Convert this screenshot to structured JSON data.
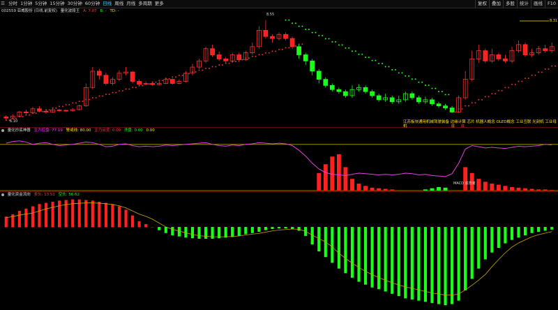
{
  "toolbar": {
    "periods": [
      "分时",
      "1分钟",
      "5分钟",
      "15分钟",
      "30分钟",
      "60分钟",
      "日线",
      "周线",
      "月线",
      "多周期",
      "更多"
    ],
    "active_period": "日线",
    "right_buttons": [
      "复权",
      "叠加",
      "多股",
      "统计",
      "画线",
      "F10"
    ]
  },
  "main_panel": {
    "header": [
      "002559 亚威股份 (日线,前复权)",
      "量化波段王",
      "A: 7.07",
      "B: -",
      "TD: -"
    ],
    "high_label": "8.55",
    "low_label": "6.10",
    "right_value": "8.31",
    "concepts_line1": "江苏板块通用机械驾驶装备 边缘计算 芯片 机器人概念 OLED概念 工业互联 光刻机 工业母机",
    "buy_tags": [
      "底",
      "底"
    ]
  },
  "kdj_panel": {
    "header": [
      "量化抄底神器",
      "主力控盘: 77.19",
      "警戒线: 80.00",
      "主力出货: 0.00",
      "洗盘: 0.00",
      "0.00"
    ],
    "macd_label": "MACD 底背离"
  },
  "flow_panel": {
    "header": [
      "量化资金流向",
      "多头: 13.51",
      "空头: 56.62"
    ]
  },
  "chart_data": {
    "type": "candlestick",
    "x_count": 83,
    "candles": [
      [
        6.18,
        6.15,
        6.22,
        6.1
      ],
      [
        6.15,
        6.2,
        6.24,
        6.12
      ],
      [
        6.2,
        6.3,
        6.33,
        6.18
      ],
      [
        6.3,
        6.28,
        6.36,
        6.24
      ],
      [
        6.28,
        6.38,
        6.42,
        6.26
      ],
      [
        6.38,
        6.32,
        6.44,
        6.3
      ],
      [
        6.32,
        6.3,
        6.36,
        6.26
      ],
      [
        6.3,
        6.35,
        6.38,
        6.28
      ],
      [
        6.35,
        6.34,
        6.38,
        6.3
      ],
      [
        6.34,
        6.33,
        6.36,
        6.3
      ],
      [
        6.33,
        6.36,
        6.4,
        6.31
      ],
      [
        6.36,
        6.45,
        6.48,
        6.34
      ],
      [
        6.45,
        6.9,
        7.0,
        6.43
      ],
      [
        6.9,
        7.3,
        7.4,
        6.85
      ],
      [
        7.3,
        7.2,
        7.36,
        7.1
      ],
      [
        7.2,
        7.0,
        7.26,
        6.95
      ],
      [
        7.0,
        7.1,
        7.15,
        6.95
      ],
      [
        7.1,
        7.25,
        7.32,
        7.05
      ],
      [
        7.25,
        7.28,
        7.4,
        7.2
      ],
      [
        7.28,
        7.05,
        7.3,
        7.0
      ],
      [
        7.05,
        6.98,
        7.1,
        6.95
      ],
      [
        6.98,
        7.0,
        7.05,
        6.95
      ],
      [
        7.0,
        6.97,
        7.05,
        6.94
      ],
      [
        6.97,
        7.0,
        7.05,
        6.95
      ],
      [
        7.0,
        7.1,
        7.15,
        6.98
      ],
      [
        7.1,
        7.0,
        7.12,
        6.97
      ],
      [
        7.0,
        7.05,
        7.1,
        6.98
      ],
      [
        7.05,
        7.25,
        7.3,
        7.02
      ],
      [
        7.25,
        7.4,
        7.48,
        7.2
      ],
      [
        7.4,
        7.55,
        7.6,
        7.35
      ],
      [
        7.55,
        7.85,
        7.9,
        7.5
      ],
      [
        7.85,
        7.7,
        7.95,
        7.65
      ],
      [
        7.7,
        7.6,
        7.78,
        7.55
      ],
      [
        7.6,
        7.55,
        7.65,
        7.5
      ],
      [
        7.55,
        7.7,
        7.75,
        7.5
      ],
      [
        7.7,
        7.58,
        7.75,
        7.52
      ],
      [
        7.58,
        7.75,
        7.8,
        7.55
      ],
      [
        7.75,
        7.9,
        8.0,
        7.7
      ],
      [
        7.9,
        8.3,
        8.4,
        7.85
      ],
      [
        8.3,
        8.15,
        8.55,
        8.1
      ],
      [
        8.15,
        8.1,
        8.2,
        8.0
      ],
      [
        8.1,
        8.2,
        8.25,
        8.05
      ],
      [
        8.2,
        8.1,
        8.25,
        8.05
      ],
      [
        8.1,
        7.9,
        8.15,
        7.85
      ],
      [
        7.9,
        7.7,
        7.95,
        7.6
      ],
      [
        7.7,
        7.55,
        7.75,
        7.45
      ],
      [
        7.55,
        7.3,
        7.6,
        7.2
      ],
      [
        7.3,
        7.1,
        7.35,
        7.0
      ],
      [
        7.1,
        6.95,
        7.15,
        6.9
      ],
      [
        6.95,
        6.85,
        7.0,
        6.8
      ],
      [
        6.85,
        6.8,
        6.9,
        6.75
      ],
      [
        6.8,
        6.7,
        6.85,
        6.65
      ],
      [
        6.7,
        6.85,
        6.95,
        6.65
      ],
      [
        6.85,
        6.9,
        6.98,
        6.8
      ],
      [
        6.9,
        6.8,
        6.95,
        6.75
      ],
      [
        6.8,
        6.7,
        6.85,
        6.65
      ],
      [
        6.7,
        6.6,
        6.75,
        6.55
      ],
      [
        6.6,
        6.65,
        6.75,
        6.55
      ],
      [
        6.65,
        6.55,
        6.7,
        6.5
      ],
      [
        6.55,
        6.6,
        6.7,
        6.5
      ],
      [
        6.6,
        6.75,
        6.8,
        6.55
      ],
      [
        6.75,
        6.65,
        6.8,
        6.6
      ],
      [
        6.65,
        6.55,
        6.7,
        6.5
      ],
      [
        6.55,
        6.6,
        6.68,
        6.5
      ],
      [
        6.6,
        6.5,
        6.65,
        6.45
      ],
      [
        6.5,
        6.45,
        6.55,
        6.4
      ],
      [
        6.45,
        6.4,
        6.5,
        6.35
      ],
      [
        6.4,
        6.3,
        6.45,
        6.28
      ],
      [
        6.3,
        6.65,
        6.7,
        6.28
      ],
      [
        6.65,
        7.1,
        7.3,
        6.6
      ],
      [
        7.1,
        7.6,
        7.8,
        7.05
      ],
      [
        7.6,
        7.8,
        7.95,
        7.5
      ],
      [
        7.8,
        7.55,
        7.85,
        7.5
      ],
      [
        7.55,
        7.7,
        7.85,
        7.5
      ],
      [
        7.7,
        7.6,
        7.75,
        7.55
      ],
      [
        7.6,
        7.55,
        7.7,
        7.5
      ],
      [
        7.55,
        7.8,
        7.9,
        7.5
      ],
      [
        7.8,
        7.95,
        8.05,
        7.75
      ],
      [
        7.95,
        7.7,
        8.0,
        7.65
      ],
      [
        7.7,
        7.75,
        7.85,
        7.65
      ],
      [
        7.75,
        7.85,
        7.92,
        7.7
      ],
      [
        7.85,
        7.8,
        7.95,
        7.75
      ],
      [
        7.8,
        7.9,
        8.0,
        7.75
      ]
    ],
    "price_ylim": [
      6.0,
      8.7
    ],
    "kdj_line": [
      82,
      85,
      86,
      84,
      80,
      82,
      83,
      80,
      78,
      79,
      80,
      82,
      84,
      83,
      80,
      76,
      77,
      80,
      81,
      78,
      76,
      77,
      76,
      77,
      79,
      78,
      79,
      80,
      81,
      82,
      83,
      80,
      78,
      77,
      79,
      78,
      80,
      81,
      83,
      82,
      81,
      82,
      81,
      78,
      70,
      60,
      48,
      38,
      32,
      29,
      28,
      27,
      29,
      31,
      30,
      29,
      28,
      29,
      28,
      29,
      31,
      30,
      28,
      29,
      27,
      26,
      25,
      30,
      48,
      72,
      78,
      76,
      74,
      75,
      74,
      73,
      75,
      77,
      76,
      77,
      78,
      80,
      79
    ],
    "kdj_bars": [
      0,
      0,
      0,
      0,
      0,
      0,
      0,
      0,
      0,
      0,
      0,
      0,
      0,
      0,
      0,
      0,
      0,
      0,
      0,
      0,
      0,
      0,
      0,
      0,
      0,
      0,
      0,
      0,
      0,
      0,
      0,
      0,
      0,
      0,
      0,
      0,
      0,
      0,
      0,
      0,
      0,
      0,
      0,
      0,
      0,
      0,
      0,
      30,
      45,
      58,
      62,
      40,
      20,
      12,
      8,
      5,
      4,
      3,
      2,
      0,
      0,
      0,
      0,
      -2,
      -4,
      -6,
      -5,
      0,
      0,
      40,
      30,
      20,
      15,
      12,
      10,
      8,
      6,
      5,
      4,
      3,
      2,
      2,
      1
    ],
    "flow_values": [
      18,
      22,
      28,
      32,
      36,
      40,
      42,
      44,
      46,
      47,
      48,
      48,
      47,
      46,
      44,
      42,
      40,
      36,
      30,
      20,
      10,
      5,
      0,
      -5,
      -10,
      -14,
      -16,
      -18,
      -19,
      -20,
      -20,
      -20,
      -19,
      -18,
      -17,
      -15,
      -12,
      -10,
      -8,
      -5,
      -3,
      -2,
      -2,
      -3,
      -6,
      -15,
      -30,
      -42,
      -52,
      -62,
      -72,
      -80,
      -88,
      -95,
      -100,
      -105,
      -108,
      -112,
      -116,
      -120,
      -124,
      -126,
      -128,
      -130,
      -132,
      -134,
      -136,
      -134,
      -128,
      -110,
      -90,
      -72,
      -56,
      -44,
      -36,
      -28,
      -22,
      -18,
      -14,
      -10,
      -8,
      -6,
      -4
    ]
  }
}
